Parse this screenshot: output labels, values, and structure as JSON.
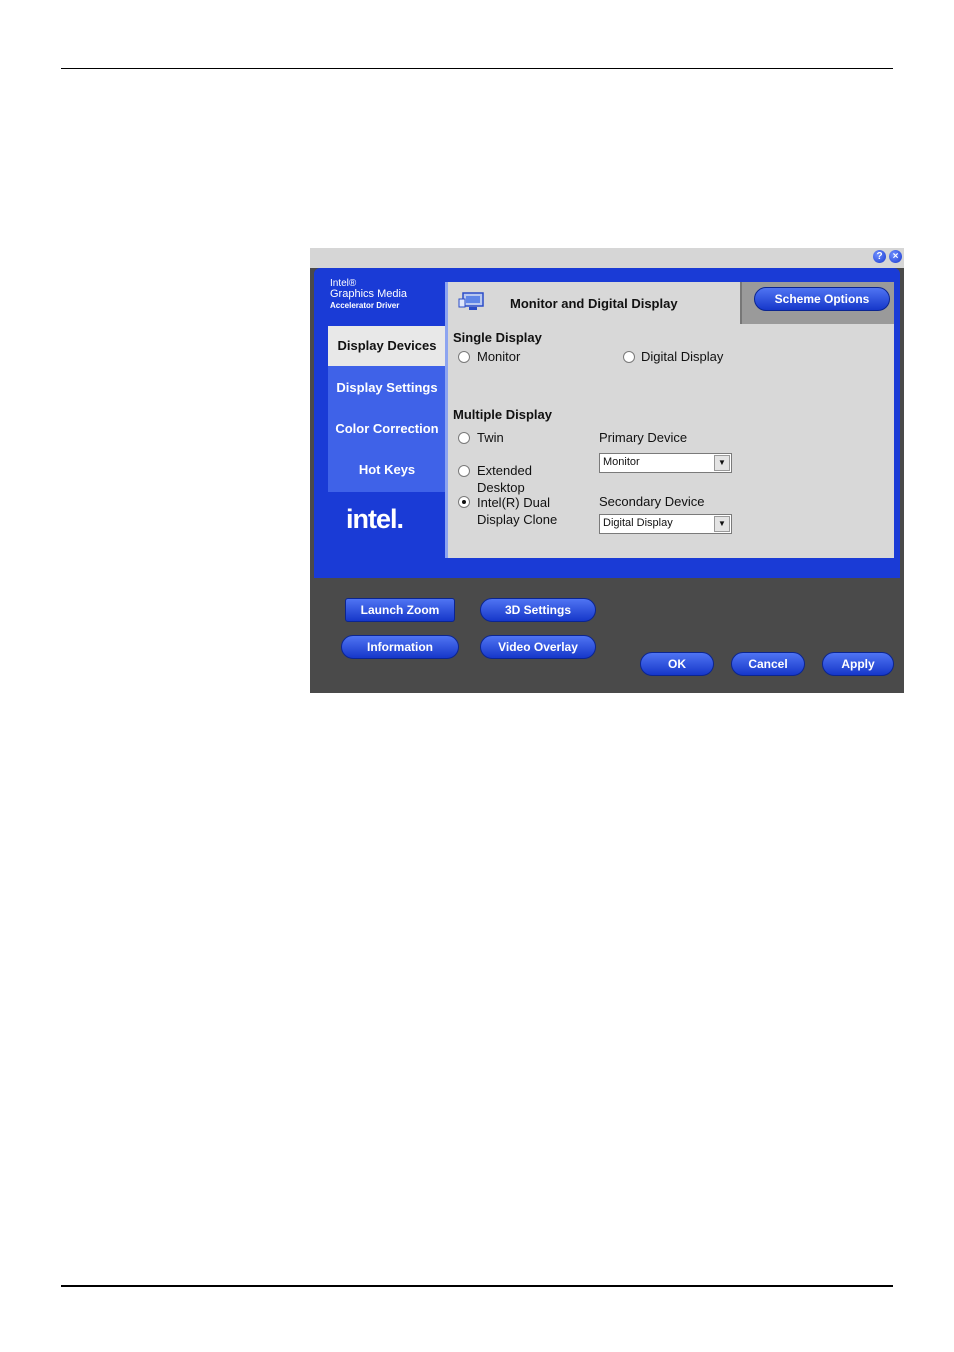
{
  "window": {
    "help_glyph": "?",
    "close_glyph": "×"
  },
  "brand": {
    "line1": "Intel®",
    "line2": "Graphics Media",
    "line3": "Accelerator Driver",
    "logo": "intel."
  },
  "sidebar": {
    "items": [
      {
        "label": "Display Devices",
        "active": true
      },
      {
        "label": "Display Settings",
        "active": false
      },
      {
        "label": "Color Correction",
        "active": false
      },
      {
        "label": "Hot Keys",
        "active": false
      }
    ]
  },
  "header": {
    "title": "Monitor and Digital Display",
    "scheme_button": "Scheme Options",
    "icon": "monitor-icon"
  },
  "single_display": {
    "title": "Single Display",
    "options": [
      {
        "label": "Monitor",
        "selected": false
      },
      {
        "label": "Digital Display",
        "selected": false
      }
    ]
  },
  "multiple_display": {
    "title": "Multiple Display",
    "twin": {
      "label": "Twin",
      "selected": false
    },
    "extended": {
      "label_line1": "Extended",
      "label_line2": "Desktop",
      "selected": false
    },
    "dual_clone": {
      "label_line1": "Intel(R) Dual",
      "label_line2": "Display Clone",
      "selected": true
    }
  },
  "primary_device": {
    "label": "Primary Device",
    "value": "Monitor"
  },
  "secondary_device": {
    "label": "Secondary Device",
    "value": "Digital Display"
  },
  "bottom_buttons": {
    "launch_zoom": "Launch Zoom",
    "settings_3d": "3D Settings",
    "information": "Information",
    "video_overlay": "Video Overlay",
    "ok": "OK",
    "cancel": "Cancel",
    "apply": "Apply"
  },
  "colors": {
    "frame_blue": "#1a3bd6",
    "panel_grey": "#d8d8d8",
    "button_blue": "#1637c9",
    "bottom_grey": "#4a4a4a"
  }
}
